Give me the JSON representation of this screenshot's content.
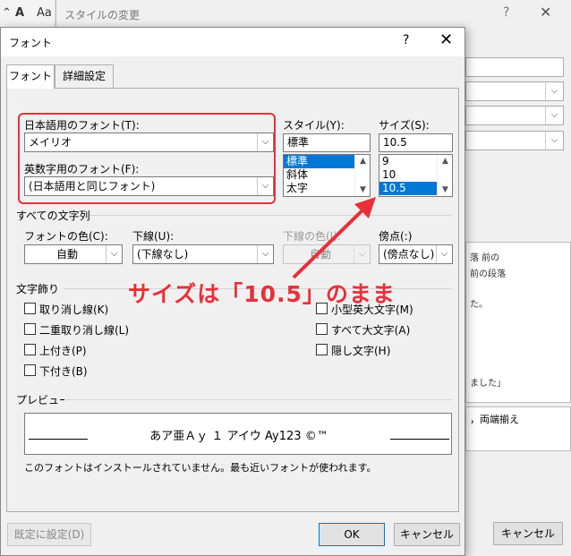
{
  "background": {
    "toolbar_glyphs": [
      "A",
      "Aa"
    ],
    "dialog_title": "スタイルの変更",
    "help_glyph": "?",
    "close_glyph": "✕",
    "chevron": "⌵",
    "preview_lines": [
      "落 前の",
      "前の段落",
      "た。",
      "ました」"
    ],
    "description_text": "，両端揃え",
    "cancel_label": "キャンセル"
  },
  "dialog": {
    "title": "フォント",
    "help_glyph": "?",
    "close_glyph": "✕",
    "tabs": [
      "フォント",
      "詳細設定"
    ],
    "japanese_font": {
      "label": "日本語用のフォント(T):",
      "value": "メイリオ"
    },
    "latin_font": {
      "label": "英数字用のフォント(F):",
      "value": "(日本語用と同じフォント)"
    },
    "style": {
      "label": "スタイル(Y):",
      "value": "標準",
      "options": [
        "標準",
        "斜体",
        "太字"
      ],
      "selected_index": 0
    },
    "size": {
      "label": "サイズ(S):",
      "value": "10.5",
      "options": [
        "9",
        "10",
        "10.5"
      ],
      "selected_index": 2
    },
    "all_text_header": "すべての文字列",
    "font_color": {
      "label": "フォントの色(C):",
      "value": "自動"
    },
    "underline": {
      "label": "下線(U):",
      "value": "(下線なし)"
    },
    "underline_color": {
      "label": "下線の色(I):",
      "value": "自動"
    },
    "emphasis": {
      "label": "傍点(:)",
      "value": "(傍点なし)"
    },
    "effects_header": "文字飾り",
    "effects_left": [
      "取り消し線(K)",
      "二重取り消し線(L)",
      "上付き(P)",
      "下付き(B)"
    ],
    "effects_right": [
      "小型英大文字(M)",
      "すべて大文字(A)",
      "隠し文字(H)"
    ],
    "preview_header": "プレビュー",
    "preview_text": "あア亜Ａｙ １ アイウ Ay123 ©™",
    "info_text": "このフォントはインストールされていません。最も近いフォントが使われます。",
    "default_button": "既定に設定(D)",
    "ok_button": "OK",
    "cancel_button": "キャンセル"
  },
  "annotation": {
    "text": "サイズは「10.5」のまま",
    "color": "#e8303a"
  },
  "icons": {
    "dropdown": "⌵",
    "scroll_up": "▲",
    "scroll_down": "▼"
  }
}
